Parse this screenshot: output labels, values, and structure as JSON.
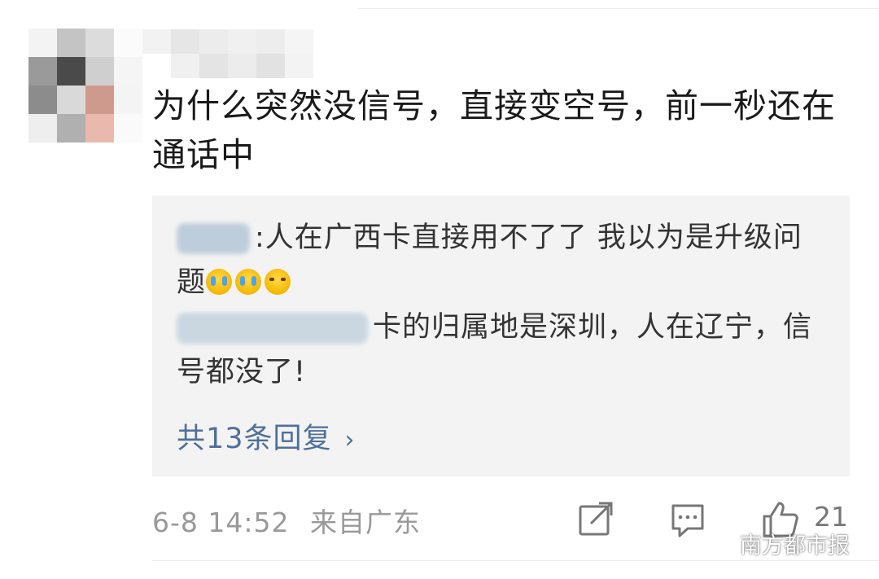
{
  "comment": {
    "text": "为什么突然没信号，直接变空号，前一秒还在通话中"
  },
  "replies": [
    {
      "name_suffix": ":",
      "text": "人在广西卡直接用不了了 我以为是升级问题",
      "emojis": [
        "crying-face-icon",
        "crying-face-icon",
        "laughing-crying-face-icon"
      ]
    },
    {
      "text": "卡的归属地是深圳，人在辽宁，信号都没了!"
    }
  ],
  "more_replies": {
    "label": "共13条回复",
    "chevron": "›"
  },
  "meta": {
    "date": "6-8 14:52",
    "location": "来自广东"
  },
  "actions": {
    "like_count": "21"
  },
  "watermark": {
    "text": "南方都市报"
  },
  "colors": {
    "link": "#4e6f9d",
    "reply_bg": "#f3f3f3",
    "meta": "#999999"
  }
}
